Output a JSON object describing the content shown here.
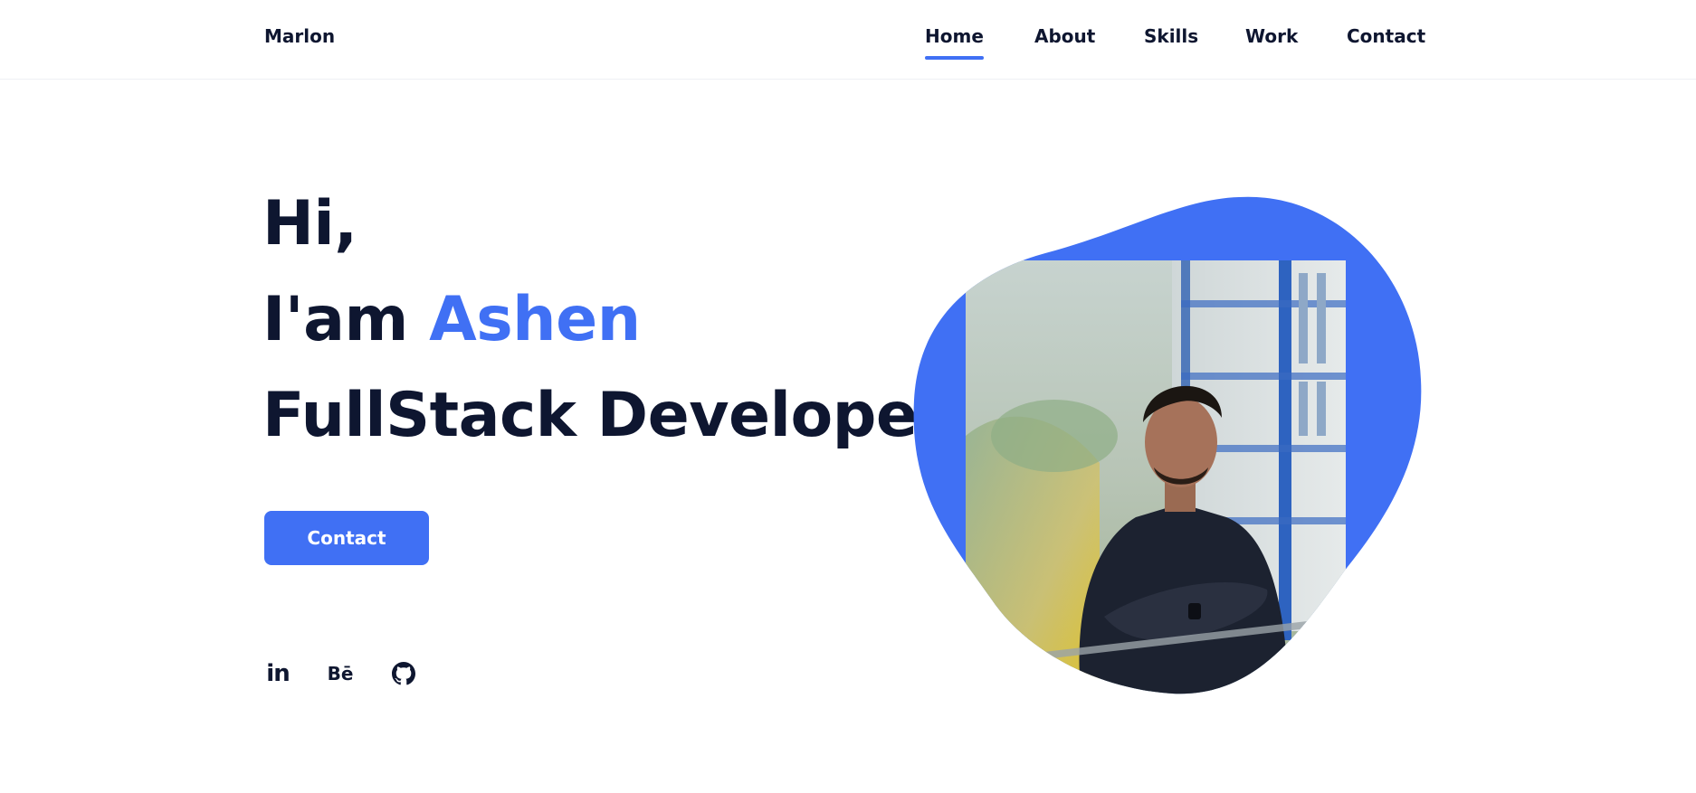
{
  "header": {
    "logo": "Marlon",
    "nav": [
      {
        "label": "Home",
        "active": true
      },
      {
        "label": "About",
        "active": false
      },
      {
        "label": "Skills",
        "active": false
      },
      {
        "label": "Work",
        "active": false
      },
      {
        "label": "Contact",
        "active": false
      }
    ]
  },
  "hero": {
    "line1": "Hi,",
    "line2_prefix": "I'am",
    "line2_name": "Ashen",
    "line3": "FullStack Developer",
    "button_label": "Contact",
    "social": [
      {
        "icon": "linkedin-icon",
        "text": "in"
      },
      {
        "icon": "behance-icon",
        "text": "Bē"
      },
      {
        "icon": "github-icon",
        "text": ""
      }
    ],
    "photo": {
      "subject": "man-with-crossed-arms-portrait"
    }
  },
  "colors": {
    "accent": "#4070f4",
    "text": "#0e1630",
    "background": "#ffffff"
  }
}
